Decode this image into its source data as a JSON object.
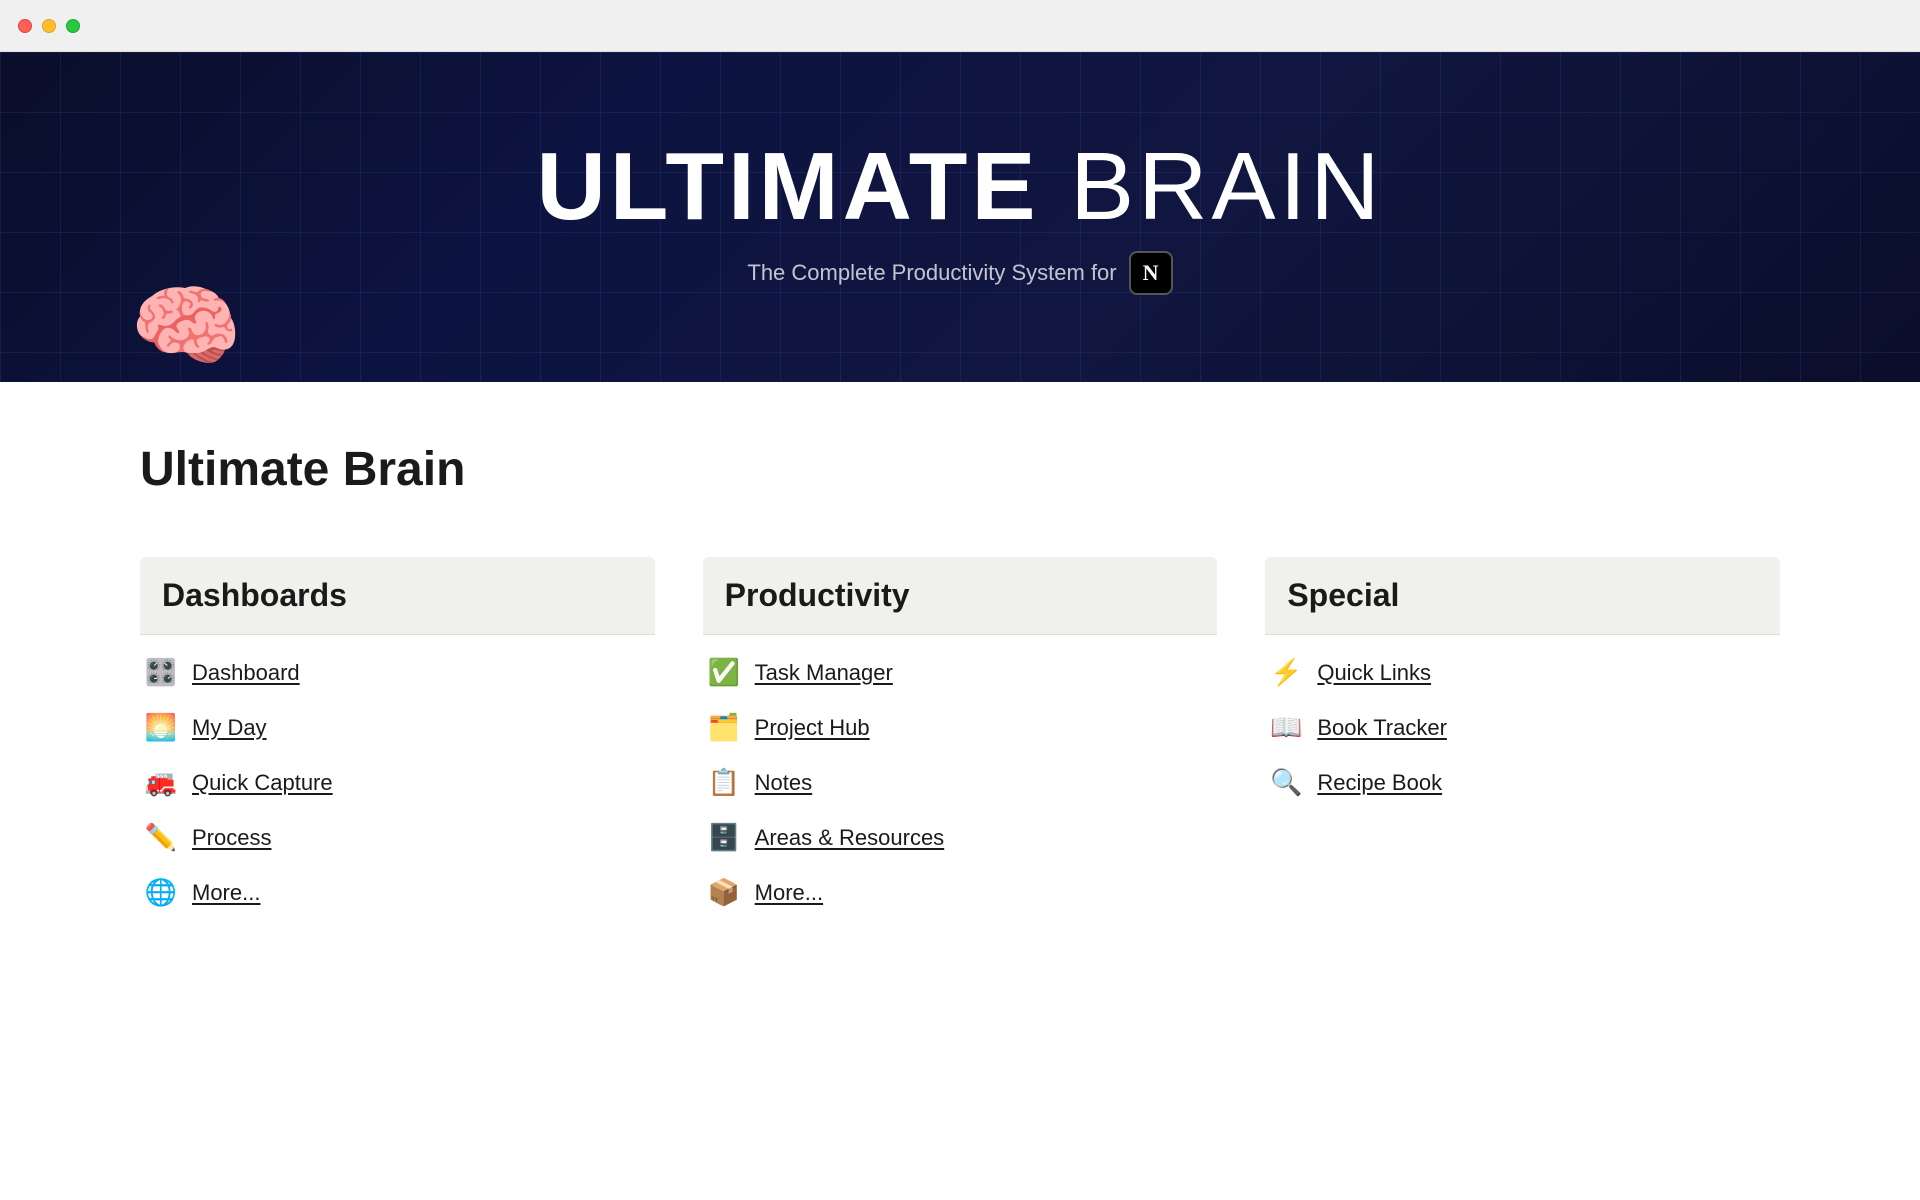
{
  "window": {
    "traffic_lights": [
      "red",
      "yellow",
      "green"
    ]
  },
  "hero": {
    "title_bold": "ULTIMATE",
    "title_light": "BRAIN",
    "subtitle_text": "The Complete Productivity System for",
    "notion_symbol": "N",
    "brain_emoji": "🧠"
  },
  "page": {
    "title": "Ultimate Brain"
  },
  "columns": [
    {
      "id": "dashboards",
      "header": "Dashboards",
      "items": [
        {
          "icon": "🎛️",
          "label": "Dashboard"
        },
        {
          "icon": "🌅",
          "label": "My Day"
        },
        {
          "icon": "🚒",
          "label": "Quick Capture"
        },
        {
          "icon": "✏️",
          "label": "Process"
        },
        {
          "icon": "🌐",
          "label": "More..."
        }
      ]
    },
    {
      "id": "productivity",
      "header": "Productivity",
      "items": [
        {
          "icon": "✅",
          "label": "Task Manager"
        },
        {
          "icon": "🗂️",
          "label": "Project Hub"
        },
        {
          "icon": "📋",
          "label": "Notes"
        },
        {
          "icon": "🗄️",
          "label": "Areas & Resources"
        },
        {
          "icon": "📦",
          "label": "More..."
        }
      ]
    },
    {
      "id": "special",
      "header": "Special",
      "items": [
        {
          "icon": "⚡",
          "label": "Quick Links"
        },
        {
          "icon": "📖",
          "label": "Book Tracker"
        },
        {
          "icon": "🔍",
          "label": "Recipe Book"
        }
      ]
    }
  ]
}
